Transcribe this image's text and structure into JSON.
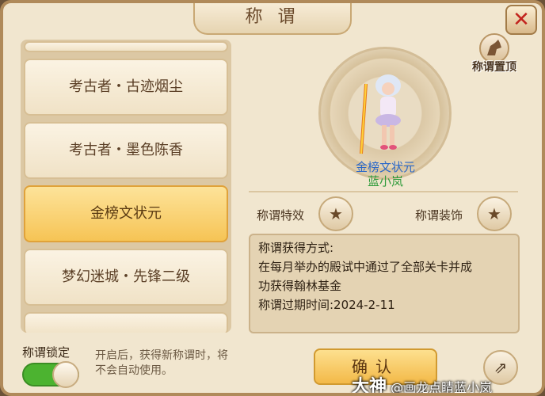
{
  "window": {
    "title": "称 谓",
    "close_glyph": "✕"
  },
  "title_list": {
    "items": [
      {
        "label": ""
      },
      {
        "label": "考古者・古迹烟尘"
      },
      {
        "label": "考古者・墨色陈香"
      },
      {
        "label": "金榜文状元",
        "selected": true
      },
      {
        "label": "梦幻迷城・先锋二级"
      },
      {
        "label": ""
      }
    ]
  },
  "character": {
    "title": "金榜文状元",
    "name": "蓝小岚"
  },
  "pin_button": {
    "label": "称谓置顶",
    "icon": "horse-icon"
  },
  "effects": {
    "label": "称谓特效",
    "icon": "star-icon",
    "glyph": "★"
  },
  "decor": {
    "label": "称谓装饰",
    "icon": "star-icon",
    "glyph": "★"
  },
  "description": {
    "line1": "称谓获得方式:",
    "line2": "在每月举办的殿试中通过了全部关卡并成",
    "line3": "功获得翰林基金",
    "line4": "称谓过期时间:2024-2-11"
  },
  "lock": {
    "label": "称谓锁定",
    "enabled": true,
    "hint": "开启后，获得新称谓时，将不会自动使用。"
  },
  "confirm_button": {
    "label": "确认"
  },
  "share_button": {
    "icon": "share-icon",
    "glyph": "⇗"
  },
  "watermark": {
    "brand": "大神",
    "text": "@画龙点睛蓝小岚"
  },
  "colors": {
    "selected": "#f6c455",
    "title_blue": "#2b68c8",
    "name_green": "#2e9b3a",
    "toggle_on": "#4cb330"
  }
}
